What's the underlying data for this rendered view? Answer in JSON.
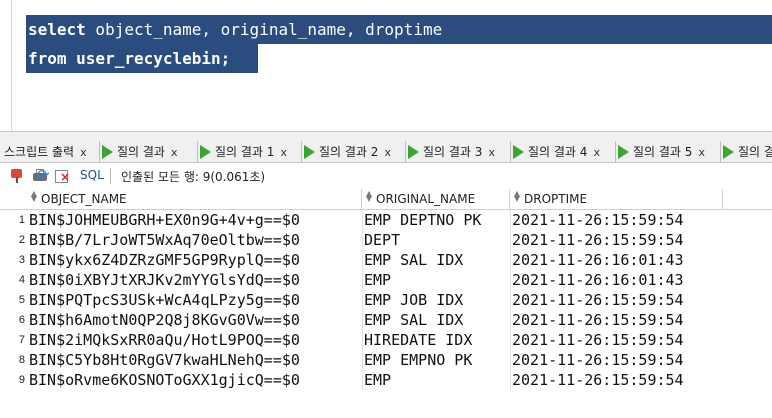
{
  "editor": {
    "line1_keyword": "select",
    "line1_rest": " object_name, original_name, droptime",
    "line2": "from user_recyclebin;"
  },
  "tabs": [
    {
      "label": "스크립트 출력",
      "close": "x"
    },
    {
      "label": "질의 결과",
      "close": "x"
    },
    {
      "label": "질의 결과 1",
      "close": "x"
    },
    {
      "label": "질의 결과 2",
      "close": "x"
    },
    {
      "label": "질의 결과 3",
      "close": "x"
    },
    {
      "label": "질의 결과 4",
      "close": "x"
    },
    {
      "label": "질의 결과 5",
      "close": "x"
    },
    {
      "label": "질의 결",
      "close": ""
    }
  ],
  "toolbar": {
    "sql_label": "SQL",
    "status": "인출된 모든 행: 9(0.061초)",
    "icons": [
      "pin-icon",
      "printer-icon",
      "refresh-icon",
      "clear-icon"
    ]
  },
  "grid": {
    "columns": [
      "OBJECT_NAME",
      "ORIGINAL_NAME",
      "DROPTIME"
    ],
    "rows": [
      {
        "num": "1",
        "object_name": "BIN$JOHMEUBGRH+EX0n9G+4v+g==$0",
        "original_name": "EMP DEPTNO PK",
        "droptime": "2021-11-26:15:59:54"
      },
      {
        "num": "2",
        "object_name": "BIN$B/7LrJoWT5WxAq70eOltbw==$0",
        "original_name": "DEPT",
        "droptime": "2021-11-26:15:59:54"
      },
      {
        "num": "3",
        "object_name": "BIN$ykx6Z4DZRzGMF5GP9RyplQ==$0",
        "original_name": "EMP SAL IDX",
        "droptime": "2021-11-26:16:01:43"
      },
      {
        "num": "4",
        "object_name": "BIN$0iXBYJtXRJKv2mYYGlsYdQ==$0",
        "original_name": "EMP",
        "droptime": "2021-11-26:16:01:43"
      },
      {
        "num": "5",
        "object_name": "BIN$PQTpcS3USk+WcA4qLPzy5g==$0",
        "original_name": "EMP JOB IDX",
        "droptime": "2021-11-26:15:59:54"
      },
      {
        "num": "6",
        "object_name": "BIN$h6AmotN0QP2Q8j8KGvG0Vw==$0",
        "original_name": "EMP SAL IDX",
        "droptime": "2021-11-26:15:59:54"
      },
      {
        "num": "7",
        "object_name": "BIN$2iMQkSxRR0aQu/HotL9POQ==$0",
        "original_name": "HIREDATE IDX",
        "droptime": "2021-11-26:15:59:54"
      },
      {
        "num": "8",
        "object_name": "BIN$C5Yb8Ht0RgGV7kwaHLNehQ==$0",
        "original_name": "EMP EMPNO PK",
        "droptime": "2021-11-26:15:59:54"
      },
      {
        "num": "9",
        "object_name": "BIN$oRvme6KOSNOToGXX1gjicQ==$0",
        "original_name": "EMP",
        "droptime": "2021-11-26:15:59:54"
      }
    ]
  },
  "colors": {
    "selection": "#2a4c7e",
    "highlighter": "#f5f500",
    "tab_play": "#3aa535"
  }
}
